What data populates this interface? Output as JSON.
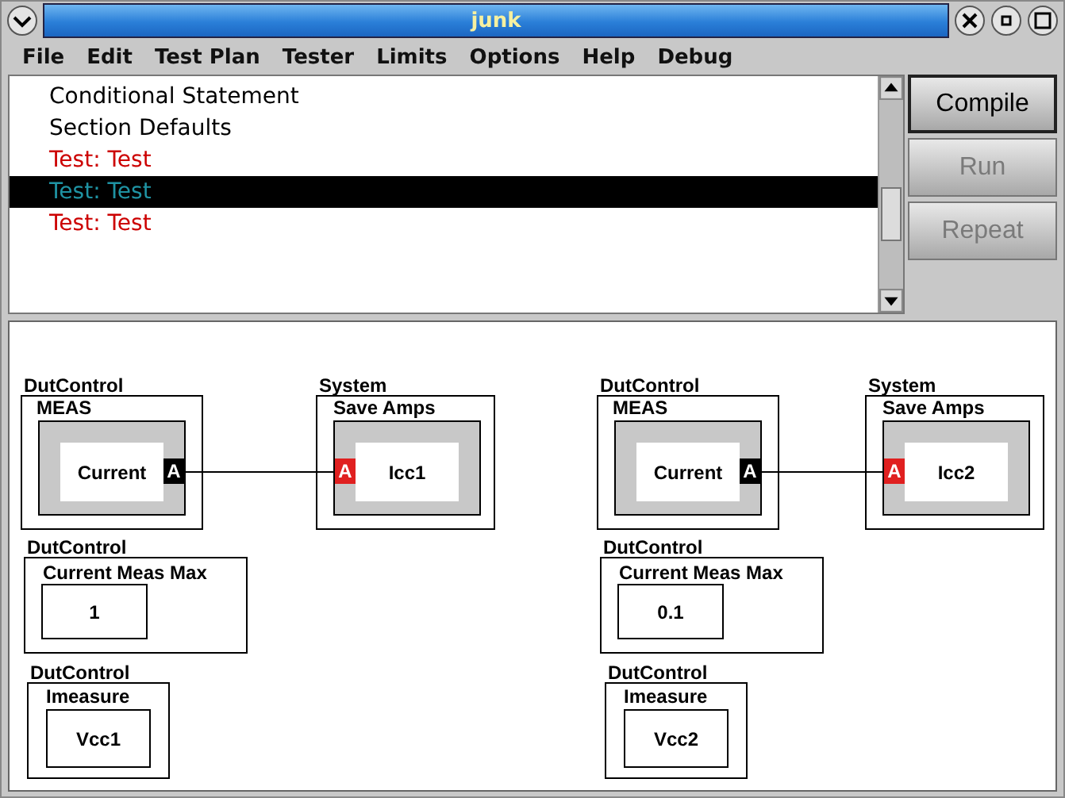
{
  "window": {
    "title": "junk"
  },
  "menu": [
    {
      "label": "File"
    },
    {
      "label": "Edit"
    },
    {
      "label": "Test Plan"
    },
    {
      "label": "Tester"
    },
    {
      "label": "Limits"
    },
    {
      "label": "Options"
    },
    {
      "label": "Help"
    },
    {
      "label": "Debug"
    }
  ],
  "list": {
    "items": [
      {
        "label": "Conditional Statement",
        "color": "#000000",
        "selected": false
      },
      {
        "label": "Section Defaults",
        "color": "#000000",
        "selected": false
      },
      {
        "label": "Test: Test",
        "color": "#cc0000",
        "selected": false
      },
      {
        "label": "Test: Test",
        "color": "#1f93a3",
        "selected": true
      },
      {
        "label": "Test: Test",
        "color": "#cc0000",
        "selected": false
      }
    ]
  },
  "buttons": [
    {
      "label": "Compile",
      "disabled": false,
      "default": true
    },
    {
      "label": "Run",
      "disabled": true,
      "default": false
    },
    {
      "label": "Repeat",
      "disabled": true,
      "default": false
    }
  ],
  "diagram": [
    {
      "source": {
        "category": "DutControl",
        "title": "MEAS",
        "block": "Current",
        "port": {
          "label": "A",
          "kind": "output"
        }
      },
      "target": {
        "category": "System",
        "title": "Save Amps",
        "block": "Icc1",
        "port": {
          "label": "A",
          "kind": "input"
        }
      },
      "limit": {
        "category": "DutControl",
        "title": "Current Meas Max",
        "value": "1"
      },
      "supply": {
        "category": "DutControl",
        "title": "Imeasure",
        "value": "Vcc1"
      }
    },
    {
      "source": {
        "category": "DutControl",
        "title": "MEAS",
        "block": "Current",
        "port": {
          "label": "A",
          "kind": "output"
        }
      },
      "target": {
        "category": "System",
        "title": "Save Amps",
        "block": "Icc2",
        "port": {
          "label": "A",
          "kind": "input"
        }
      },
      "limit": {
        "category": "DutControl",
        "title": "Current Meas Max",
        "value": "0.1"
      },
      "supply": {
        "category": "DutControl",
        "title": "Imeasure",
        "value": "Vcc2"
      }
    }
  ]
}
